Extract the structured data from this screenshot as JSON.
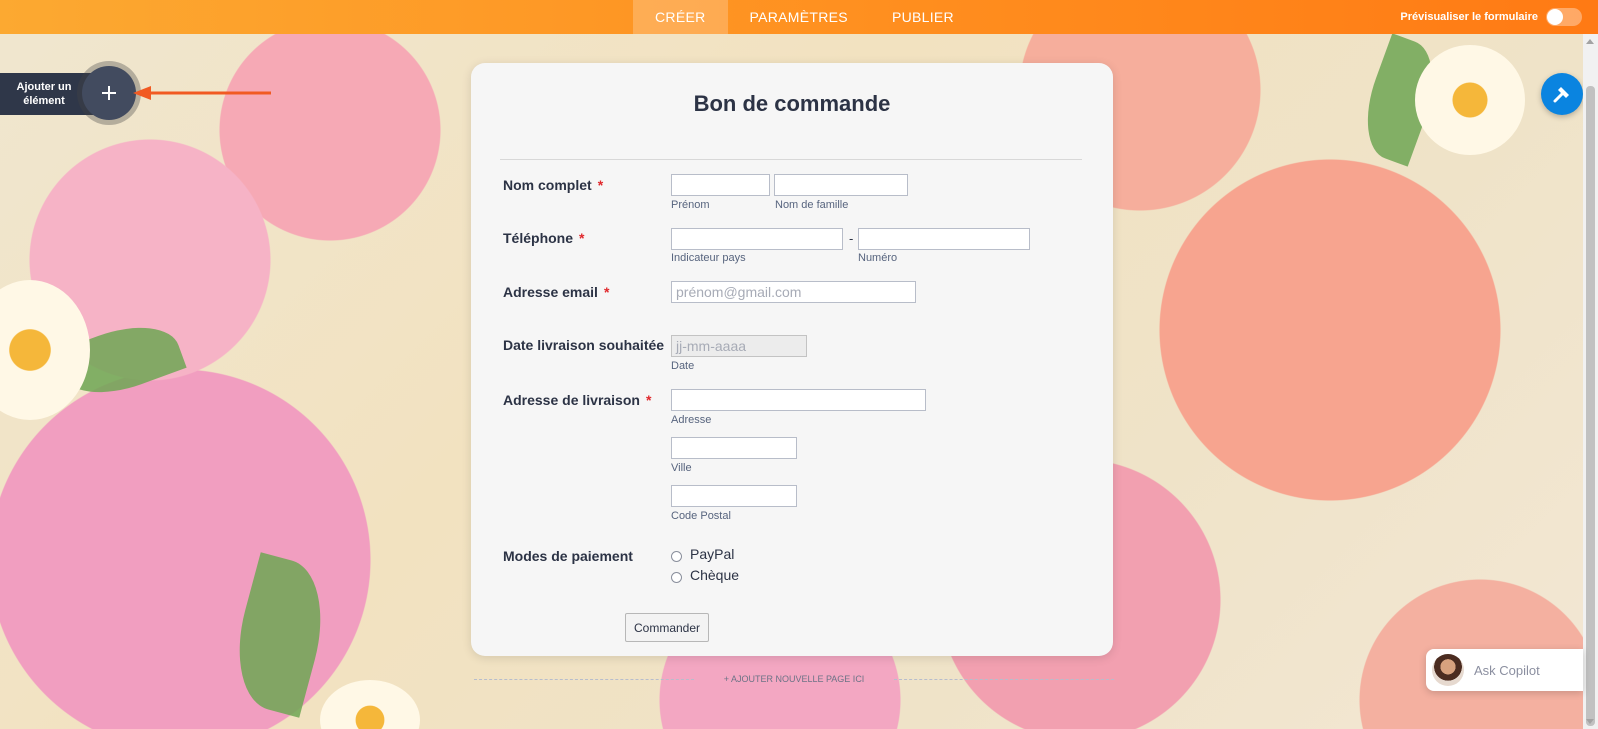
{
  "topbar": {
    "tabs": [
      {
        "label": "CRÉER",
        "active": true
      },
      {
        "label": "PARAMÈTRES",
        "active": false
      },
      {
        "label": "PUBLIER",
        "active": false
      }
    ],
    "preview_label": "Prévisualiser le formulaire"
  },
  "add_element": {
    "label": "Ajouter un élément",
    "icon": "plus-icon"
  },
  "form": {
    "title": "Bon de commande",
    "fields": {
      "full_name": {
        "label": "Nom complet",
        "required": "*",
        "first_sub": "Prénom",
        "last_sub": "Nom de famille"
      },
      "phone": {
        "label": "Téléphone",
        "required": "*",
        "dash": "-",
        "country_sub": "Indicateur pays",
        "number_sub": "Numéro"
      },
      "email": {
        "label": "Adresse email",
        "required": "*",
        "placeholder": "prénom@gmail.com"
      },
      "date": {
        "label": "Date livraison souhaitée",
        "placeholder": "jj-mm-aaaa",
        "sub": "Date"
      },
      "address": {
        "label": "Adresse de livraison",
        "required": "*",
        "street_sub": "Adresse",
        "city_sub": "Ville",
        "zip_sub": "Code Postal"
      },
      "payment": {
        "label": "Modes de paiement",
        "options": [
          "PayPal",
          "Chèque"
        ]
      }
    },
    "submit_label": "Commander"
  },
  "add_page_label": "+ AJOUTER NOUVELLE PAGE ICI",
  "copilot": {
    "label": "Ask Copilot"
  },
  "colors": {
    "accent": "#ff8f1f",
    "paint_button": "#0a84e0",
    "required": "#e0282c"
  }
}
